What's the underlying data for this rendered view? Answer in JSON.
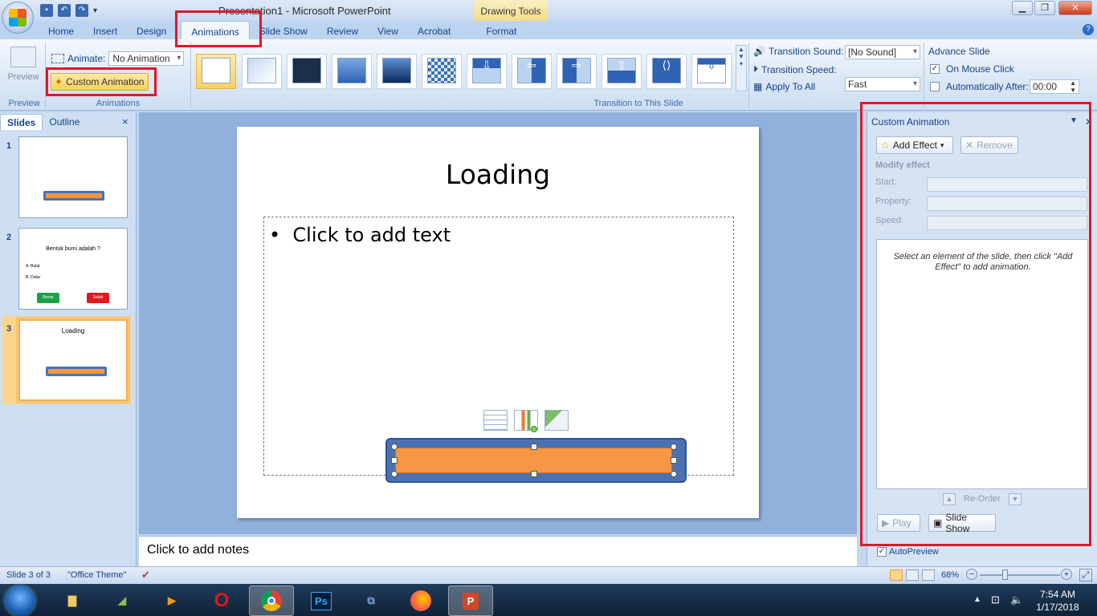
{
  "window": {
    "title": "Presentation1 - Microsoft PowerPoint",
    "contextual_tab_group": "Drawing Tools",
    "minimize": "▁",
    "restore": "❐",
    "close": "✕"
  },
  "ribbon_tabs": [
    "Home",
    "Insert",
    "Design",
    "Animations",
    "Slide Show",
    "Review",
    "View",
    "Acrobat",
    "Format"
  ],
  "active_tab": "Animations",
  "ribbon": {
    "preview_label": "Preview",
    "preview_group": "Preview",
    "animate_label": "Animate:",
    "animate_value": "No Animation",
    "custom_animation_label": "Custom Animation",
    "animations_group": "Animations",
    "transition_group": "Transition to This Slide",
    "transition_sound_label": "Transition Sound:",
    "transition_sound_value": "[No Sound]",
    "transition_speed_label": "Transition Speed:",
    "transition_speed_value": "Fast",
    "apply_to_all_label": "Apply To All",
    "advance_slide_label": "Advance Slide",
    "on_mouse_click_label": "On Mouse Click",
    "on_mouse_click_checked": true,
    "automatically_after_label": "Automatically After:",
    "automatically_after_checked": false,
    "automatically_after_value": "00:00"
  },
  "slides_panel": {
    "tabs": [
      "Slides",
      "Outline"
    ],
    "close": "×",
    "thumbnails": [
      {
        "number": "1"
      },
      {
        "number": "2",
        "title": "Bentuk bumi adalah ?",
        "option_a": "A. Bulat",
        "option_b": "B. Datar",
        "btn_correct": "Benar",
        "btn_wrong": "Salah"
      },
      {
        "number": "3",
        "title": "Loading"
      }
    ],
    "selected_slide": 3
  },
  "slide": {
    "title": "Loading",
    "content_placeholder": "Click to add text",
    "bullet": "•"
  },
  "notes_placeholder": "Click to add notes",
  "custom_animation_pane": {
    "title": "Custom Animation",
    "add_effect": "Add Effect",
    "remove": "Remove",
    "modify_effect": "Modify effect",
    "start_label": "Start:",
    "property_label": "Property:",
    "speed_label": "Speed:",
    "list_hint": "Select an element of the slide, then click \"Add Effect\" to add animation.",
    "reorder": "Re-Order",
    "play": "Play",
    "slide_show": "Slide Show",
    "autopreview": "AutoPreview",
    "autopreview_checked": true
  },
  "status_bar": {
    "slide_info": "Slide 3 of 3",
    "theme": "\"Office Theme\"",
    "zoom": "68%"
  },
  "taskbar": {
    "time": "7:54 AM",
    "date": "1/17/2018"
  },
  "colors": {
    "highlight_red": "#e0172a",
    "bar_orange": "#f79646",
    "bar_blue": "#4a72b2"
  }
}
